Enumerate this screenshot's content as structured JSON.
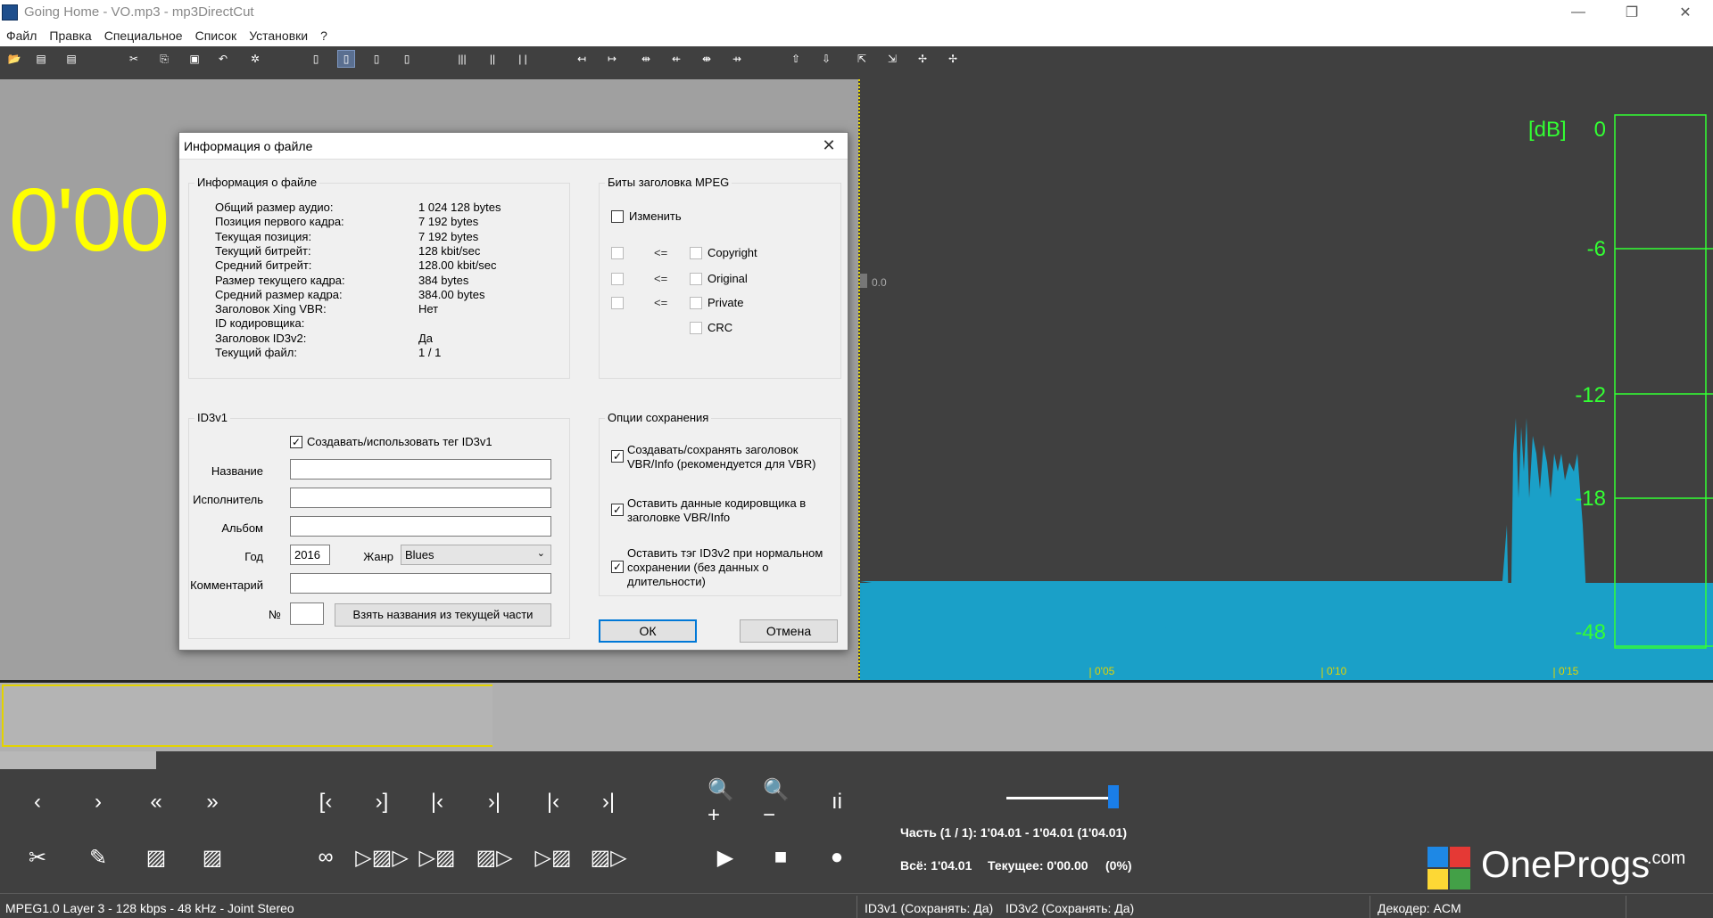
{
  "window": {
    "title": "Going Home - VO.mp3 - mp3DirectCut",
    "minimize": "—",
    "restore": "❐",
    "close": "✕"
  },
  "menu": [
    "Файл",
    "Правка",
    "Специальное",
    "Список",
    "Установки",
    "?"
  ],
  "toolbar": {
    "icons": [
      "open-icon",
      "save-icon",
      "save-split-icon",
      "cut-icon",
      "copy-icon",
      "paste-icon",
      "undo-icon",
      "settings-icon",
      "doc-icon",
      "doc-info-icon",
      "doc-edit-icon",
      "doc-tag-icon",
      "barcode-icon",
      "bars-icon",
      "pause-bars-icon",
      "marker-left-icon",
      "marker-right-icon",
      "split-icon",
      "split-left-icon",
      "split-both-icon",
      "split-right-icon",
      "level-up-icon",
      "level-down-icon",
      "fade-in-icon",
      "fade-out-icon",
      "crossfade-icon",
      "normalize-icon"
    ]
  },
  "left_panel": {
    "time": "0'00"
  },
  "waveform": {
    "marker_value": "0.0",
    "timeline": [
      "0'05",
      "0'10",
      "0'15"
    ],
    "level_fraction_baseline": 0.25,
    "wave_color": "#1aa0c8"
  },
  "meter": {
    "unit": "[dB]",
    "ticks": [
      "0",
      "-6",
      "-12",
      "-18",
      "-48"
    ],
    "color": "#33ff33"
  },
  "dialog": {
    "title": "Информация о файле",
    "close": "✕",
    "file_info": {
      "title": "Информация о файле",
      "rows": [
        {
          "label": "Общий размер аудио:",
          "value": "1 024 128 bytes"
        },
        {
          "label": "Позиция первого кадра:",
          "value": "7 192 bytes"
        },
        {
          "label": "Текущая позиция:",
          "value": "7 192 bytes"
        },
        {
          "label": "Текущий битрейт:",
          "value": "128 kbit/sec"
        },
        {
          "label": "Средний битрейт:",
          "value": "128.00 kbit/sec"
        },
        {
          "label": "Размер текущего кадра:",
          "value": "384 bytes"
        },
        {
          "label": "Средний размер кадра:",
          "value": "384.00 bytes"
        },
        {
          "label": "Заголовок Xing VBR:",
          "value": "Нет"
        },
        {
          "label": "ID кодировщика:",
          "value": ""
        },
        {
          "label": "Заголовок ID3v2:",
          "value": "Да"
        },
        {
          "label": "Текущий файл:",
          "value": "1 / 1"
        }
      ]
    },
    "mpeg_bits": {
      "title": "Биты заголовка MPEG",
      "change": "Изменить",
      "arrow": "<=",
      "flags": [
        "Copyright",
        "Original",
        "Private",
        "CRC"
      ]
    },
    "id3v1": {
      "title": "ID3v1",
      "use_tag": "Создавать/использовать тег ID3v1",
      "use_tag_checked": true,
      "title_label": "Название",
      "artist_label": "Исполнитель",
      "album_label": "Альбом",
      "year_label": "Год",
      "year_value": "2016",
      "genre_label": "Жанр",
      "genre_value": "Blues",
      "comment_label": "Комментарий",
      "track_label": "№",
      "take_names_button": "Взять названия из текущей части"
    },
    "save_options": {
      "title": "Опции сохранения",
      "opt1": "Создавать/сохранять заголовок VBR/Info (рекомендуется для VBR)",
      "opt2": "Оставить данные кодировщика в заголовке VBR/Info",
      "opt3": "Оставить тэг ID3v2 при нормальном сохранении (без данных о длительности)"
    },
    "ok": "ОК",
    "cancel": "Отмена"
  },
  "playback": {
    "part": "Часть (1 / 1): 1'04.01 - 1'04.01 (1'04.01)",
    "total": "Всё: 1'04.01",
    "current": "Текущее: 0'00.00",
    "percent": "(0%)",
    "volume_fraction": 0.92
  },
  "logo": {
    "name": "OneProgs",
    "suffix": ".com"
  },
  "status": {
    "format": "MPEG1.0 Layer 3 - 128 kbps - 48 kHz - Joint Stereo",
    "id3v1": "ID3v1 (Сохранять: Да)",
    "id3v2": "ID3v2 (Сохранять: Да)",
    "decoder": "Декодер: ACM"
  }
}
